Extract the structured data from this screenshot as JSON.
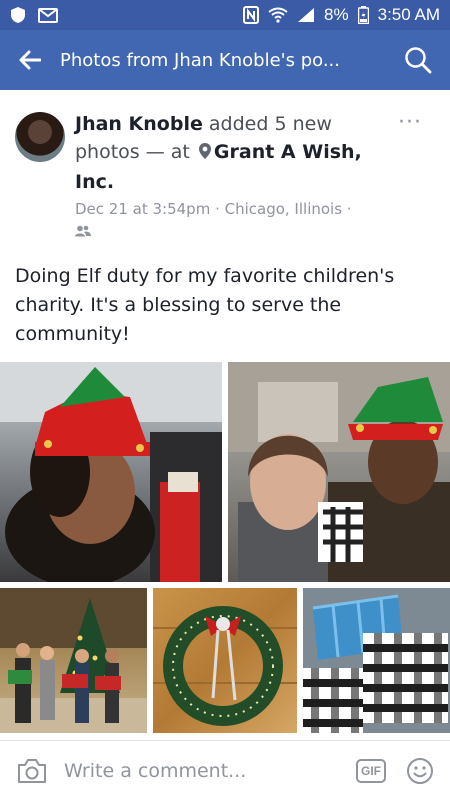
{
  "status_bar": {
    "battery": "8%",
    "time": "3:50 AM",
    "left_icons": [
      "shield-icon",
      "gmail-icon"
    ],
    "right_icons": [
      "nfc-icon",
      "wifi-icon",
      "signal-icon",
      "battery-charging-icon"
    ]
  },
  "app_bar": {
    "title": "Photos from Jhan Knoble's po...",
    "back_icon": "arrow-left-icon",
    "search_icon": "search-icon"
  },
  "post": {
    "author": "Jhan Knoble",
    "action": " added 5 new photos — at ",
    "place": "Grant A Wish, Inc.",
    "meta": "Dec 21 at 3:54pm · Chicago, Illinois ·",
    "privacy_icon": "friends-icon",
    "more_label": "···",
    "text": "Doing Elf duty for my favorite children's charity. It's a blessing to serve the community!",
    "photos": [
      {
        "description": "selfie-elf-hat-car"
      },
      {
        "description": "two-women-elf-hat"
      },
      {
        "description": "group-with-presents-christmas-tree"
      },
      {
        "description": "christmas-wreath"
      },
      {
        "description": "wrapped-gift-boxes"
      }
    ]
  },
  "comment_bar": {
    "placeholder": "Write a comment...",
    "gif_label": "GIF",
    "camera_icon": "camera-icon",
    "emoji_icon": "smiley-icon"
  },
  "colors": {
    "status_bar": "#3b5ba7",
    "app_bar": "#4267b2",
    "text_primary": "#1d2129",
    "text_secondary": "#90949c"
  }
}
